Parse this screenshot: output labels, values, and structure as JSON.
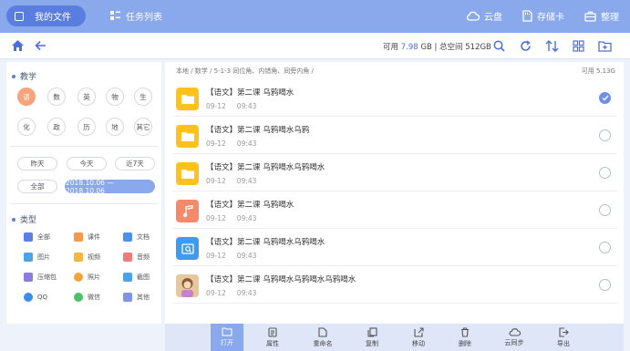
{
  "topbar": {
    "my_files": "我的文件",
    "task_list": "任务列表",
    "cloud": "云盘",
    "storage_card": "存储卡",
    "organize": "整理"
  },
  "toolbar": {
    "available_label": "可用",
    "available_value": "7.98",
    "available_unit": "GB | 总空间 512GB"
  },
  "filter": {
    "subject_title": "教学",
    "subjects": [
      "语",
      "数",
      "英",
      "物",
      "生",
      "化",
      "政",
      "历",
      "地",
      "其它"
    ],
    "dates": [
      "昨天",
      "今天",
      "近7天"
    ],
    "all_label": "全部",
    "date_range": "2018.10.06 — 2018.10.06",
    "type_title": "类型",
    "types": [
      "全部",
      "课件",
      "文档",
      "图片",
      "视频",
      "音频",
      "压缩包",
      "照片",
      "截图",
      "QQ",
      "微信",
      "其他"
    ]
  },
  "files": {
    "breadcrumb": "本地 / 数学 / 5-1-3 同位角、内错角、同旁内角 /",
    "available": "可用 5.13G",
    "items": [
      {
        "name": "【语文】第二课 乌鸦喝水",
        "date": "09-12",
        "time": "09:43",
        "kind": "folder",
        "checked": true
      },
      {
        "name": "【语文】第二课 乌鸦喝水乌鸦",
        "date": "09-12",
        "time": "09:43",
        "kind": "folder",
        "checked": false
      },
      {
        "name": "【语文】第二课 乌鸦喝水乌鸦喝水",
        "date": "09-12",
        "time": "09:43",
        "kind": "folder",
        "checked": false
      },
      {
        "name": "【语文】第二课 乌鸦喝水",
        "date": "09-12",
        "time": "09:43",
        "kind": "music",
        "checked": false
      },
      {
        "name": "【语文】第二课 乌鸦喝水乌鸦喝水",
        "date": "09-12",
        "time": "09:43",
        "kind": "image",
        "checked": false
      },
      {
        "name": "【语文】第二课 乌鸦喝水乌鸦喝水乌鸦喝水",
        "date": "09-12",
        "time": "09:43",
        "kind": "photo",
        "checked": false
      }
    ]
  },
  "actions": [
    "打开",
    "属性",
    "重命名",
    "复制",
    "移动",
    "删除",
    "云同步",
    "导出"
  ],
  "colors": {
    "accent": "#8aa8ec",
    "accent_dark": "#5a7ee0",
    "folder": "#ffc21a",
    "music": "#f58a6a",
    "image": "#3f9bf2",
    "subject_active": "#f7a37c"
  }
}
